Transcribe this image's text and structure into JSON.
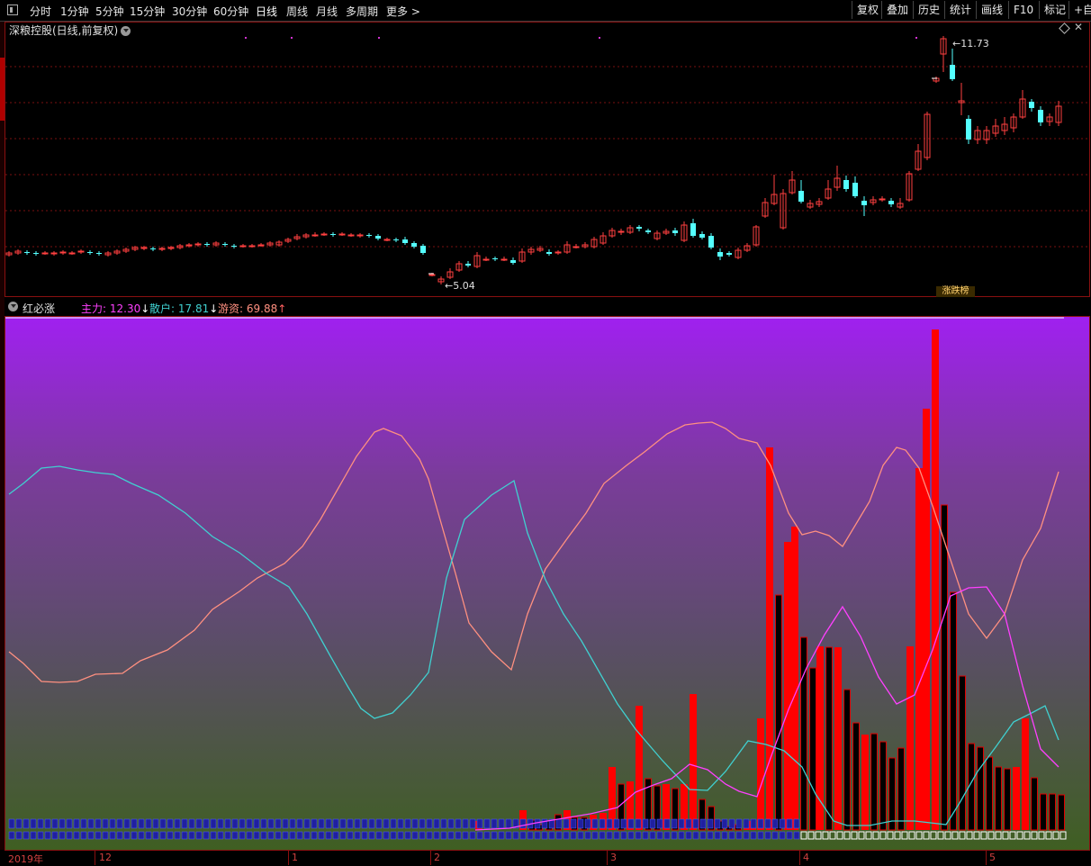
{
  "toolbar": {
    "periods": [
      "分时",
      "1分钟",
      "5分钟",
      "15分钟",
      "30分钟",
      "60分钟",
      "日线",
      "周线",
      "月线",
      "多周期",
      "更多 >"
    ],
    "active_period": "日线",
    "tools": [
      "复权",
      "叠加",
      "历史",
      "统计",
      "画线",
      "F10",
      "标记",
      "+自"
    ]
  },
  "chart": {
    "title": "深粮控股(日线,前复权)",
    "high_label": "11.73",
    "low_label": "5.04",
    "badge": "涨跌榜"
  },
  "indicator": {
    "name": "红必涨",
    "legend": [
      {
        "label": "主力:",
        "value": "12.30",
        "arrow": "↓",
        "color": "#ff40ff"
      },
      {
        "label": "散户:",
        "value": "17.81",
        "arrow": "↓",
        "color": "#40d0d0"
      },
      {
        "label": "游资:",
        "value": "69.88",
        "arrow": "↑",
        "color": "#ff9080"
      }
    ]
  },
  "xaxis": {
    "labels": [
      "2019年",
      "12",
      "1",
      "2",
      "3",
      "4",
      "5"
    ]
  },
  "colors": {
    "up": "#ff4040",
    "down": "#54ffff",
    "main": "#ff40ff",
    "retail": "#40d0d0",
    "hot": "#ff9080"
  }
}
